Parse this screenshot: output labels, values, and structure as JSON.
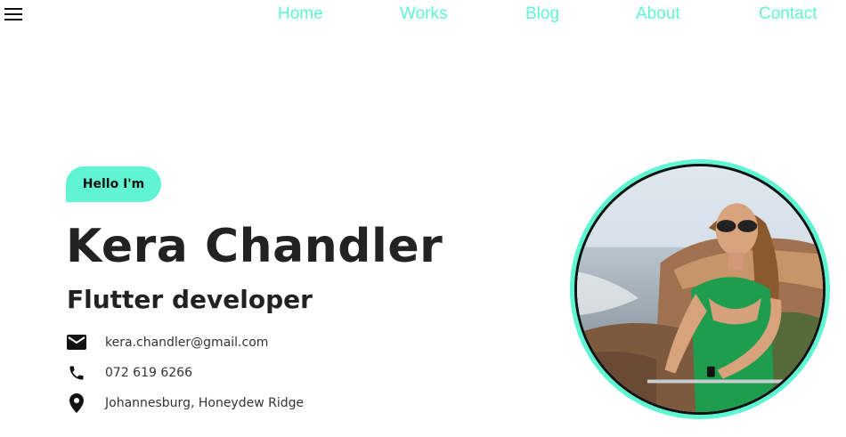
{
  "nav": {
    "menu_icon": "hamburger-menu-icon",
    "items": [
      {
        "label": "Home"
      },
      {
        "label": "Works"
      },
      {
        "label": "Blog"
      },
      {
        "label": "About"
      },
      {
        "label": "Contact"
      }
    ],
    "color": "#5ff5d2"
  },
  "hero": {
    "greeting": "Hello I'm",
    "name": "Kera Chandler",
    "role": "Flutter developer",
    "accent": "#5ff5d2"
  },
  "contact": {
    "email": {
      "icon": "email-icon",
      "value": "kera.chandler@gmail.com"
    },
    "phone": {
      "icon": "phone-icon",
      "value": "072 619 6266"
    },
    "location": {
      "icon": "location-pin-icon",
      "value": "Johannesburg, Honeydew Ridge"
    }
  },
  "profile_photo": {
    "icon": "profile-photo"
  }
}
